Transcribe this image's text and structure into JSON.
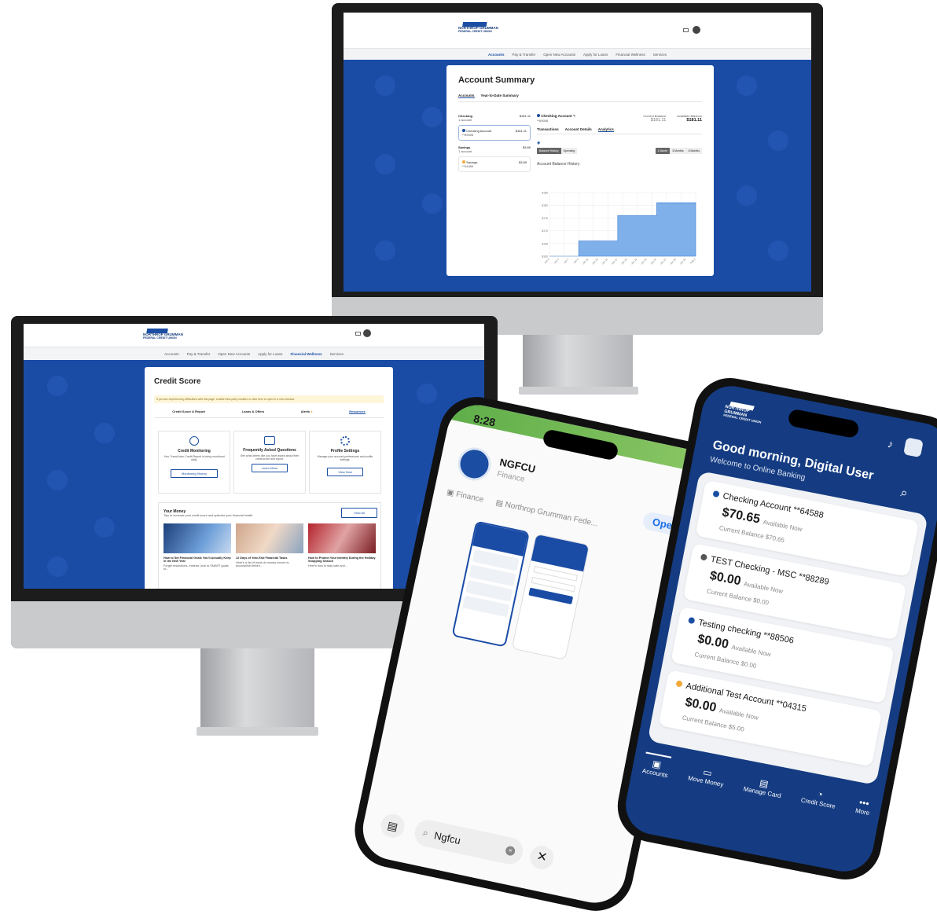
{
  "brand": {
    "name": "NORTHROP GRUMMAN",
    "sub": "FEDERAL CREDIT UNION"
  },
  "desktop_nav": [
    "Accounts",
    "Pay & Transfer",
    "Open New Accounts",
    "Apply for Loans",
    "Financial Wellness",
    "Services"
  ],
  "monitor1": {
    "title": "Account Summary",
    "tabs": [
      "Accounts",
      "Year-to-Date Summary"
    ],
    "sidebar": [
      {
        "group": "Checking",
        "sub": "1 account",
        "amount": "$181.11"
      },
      {
        "name": "Checking Account",
        "num": "**89006",
        "amount": "$181.11"
      },
      {
        "group": "Savings",
        "sub": "1 account",
        "amount": "$3.89"
      },
      {
        "name": "Savings",
        "num": "**04459",
        "amount": "$3.89"
      }
    ],
    "detail": {
      "name": "Checking Account",
      "num": "**89006",
      "current_label": "Current Balance",
      "current": "$181.11",
      "available_label": "Available Balance",
      "available": "$181.11",
      "tabs": [
        "Transactions",
        "Account Details",
        "Analytics"
      ],
      "sub_tabs": [
        "Balance History",
        "Spending"
      ],
      "ranges": [
        "1 Month",
        "3 Months",
        "6 Months"
      ],
      "chart_title": "Account Balance History"
    },
    "chart_data": {
      "type": "area",
      "title": "Account Balance History",
      "x": [
        "Jan 3",
        "Jan 5",
        "Jan 7",
        "Jan 9",
        "Jan 11",
        "Jan 13",
        "Jan 15",
        "Jan 17",
        "Jan 19",
        "Jan 21",
        "Jan 23",
        "Jan 25",
        "Jan 27",
        "Jan 29",
        "Jan 31",
        "Feb 2"
      ],
      "values": [
        160,
        160,
        160,
        166,
        166,
        166,
        166,
        176,
        176,
        176,
        176,
        181,
        181,
        181,
        181,
        181
      ],
      "ylim": [
        160,
        185
      ],
      "yticks": [
        "$185",
        "$180",
        "$175",
        "$170",
        "$165",
        "$160"
      ]
    }
  },
  "monitor2": {
    "title": "Credit Score",
    "notice": "If you are experiencing difficulties with this page, enable third-party cookies or click here to open in a new window",
    "tabs": [
      "Credit Score & Report",
      "Loans & Offers",
      "Alerts",
      "Resources"
    ],
    "tiles": [
      {
        "title": "Credit Monitoring",
        "text": "Your TransUnion Credit Report is being monitored daily.",
        "button": "Monitoring History"
      },
      {
        "title": "Frequently Asked Questions",
        "text": "See what others like you have asked about their credit score and report.",
        "button": "Learn More"
      },
      {
        "title": "Profile Settings",
        "text": "Manage your account preferences and profile settings.",
        "button": "View Now"
      }
    ],
    "money": {
      "title": "Your Money",
      "sub": "Tips to increase your credit score and optimize your financial health.",
      "button": "View All",
      "articles": [
        {
          "title": "How to Set Financial Goals You'll Actually Keep in the New Year",
          "text": "Forget resolutions. Instead, look to SMART goals to..."
        },
        {
          "title": "12 Days of Year-End Financial Tasks",
          "text": "Here's a list of must-do money moves to accomplish before..."
        },
        {
          "title": "How to Protect Your Identity During the Holiday Shopping Season",
          "text": "Here's how to stay safe and..."
        }
      ]
    }
  },
  "phone1": {
    "time": "8:28",
    "app_name": "NGFCU",
    "category": "Finance",
    "open": "Open",
    "meta_category": "Finance",
    "developer": "Northrop Grumman Fede...",
    "search": "Ngfcu"
  },
  "phone2": {
    "greeting": "Good morning, Digital User",
    "welcome": "Welcome to Online Banking",
    "accounts": [
      {
        "name": "Checking Account",
        "num": "**64588",
        "amount": "$70.65",
        "avail": "Available Now",
        "current": "Current Balance $70.65",
        "color": "#1b4ea3"
      },
      {
        "name": "TEST Checking - MSC",
        "num": "**88289",
        "amount": "$0.00",
        "avail": "Available Now",
        "current": "Current Balance $0.00",
        "color": "#555555"
      },
      {
        "name": "Testing checking",
        "num": "**88506",
        "amount": "$0.00",
        "avail": "Available Now",
        "current": "Current Balance $0.00",
        "color": "#1b4ea3"
      },
      {
        "name": "Additional Test Account",
        "num": "**04315",
        "amount": "$0.00",
        "avail": "Available Now",
        "current": "Current Balance $5.00",
        "color": "#f2a93b"
      }
    ],
    "tabs": [
      "Accounts",
      "Move Money",
      "Manage Card",
      "Credit Score",
      "More"
    ]
  },
  "colors": {
    "brand_blue": "#1a4ca6",
    "navy": "#143a7b"
  }
}
